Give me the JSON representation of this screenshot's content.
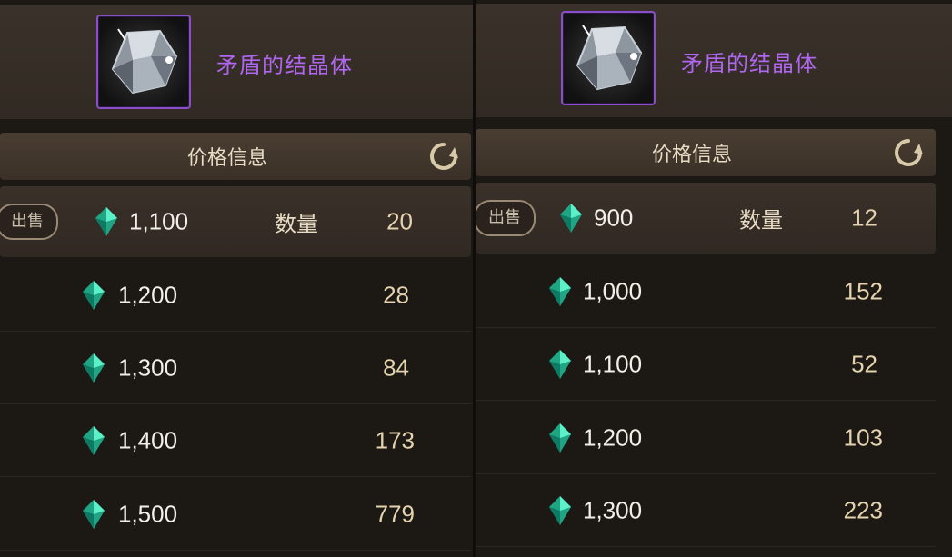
{
  "left": {
    "item_name": "矛盾的结晶体",
    "price_header": "价格信息",
    "sell_label": "出售",
    "qty_label": "数量",
    "rows": [
      {
        "price": "1,100",
        "qty": "20"
      },
      {
        "price": "1,200",
        "qty": "28"
      },
      {
        "price": "1,300",
        "qty": "84"
      },
      {
        "price": "1,400",
        "qty": "173"
      },
      {
        "price": "1,500",
        "qty": "779"
      }
    ]
  },
  "right": {
    "item_name": "矛盾的结晶体",
    "price_header": "价格信息",
    "sell_label": "出售",
    "qty_label": "数量",
    "rows": [
      {
        "price": "900",
        "qty": "12"
      },
      {
        "price": "1,000",
        "qty": "152"
      },
      {
        "price": "1,100",
        "qty": "52"
      },
      {
        "price": "1,200",
        "qty": "103"
      },
      {
        "price": "1,300",
        "qty": "223"
      }
    ]
  },
  "icons": {
    "item": "crystal-icon",
    "refresh": "refresh-icon",
    "currency": "gem-icon"
  },
  "colors": {
    "item_name": "#b066f0",
    "icon_border": "#8a4ec9",
    "qty_text": "#e4d3ae",
    "gem": "#2fd6a6"
  }
}
